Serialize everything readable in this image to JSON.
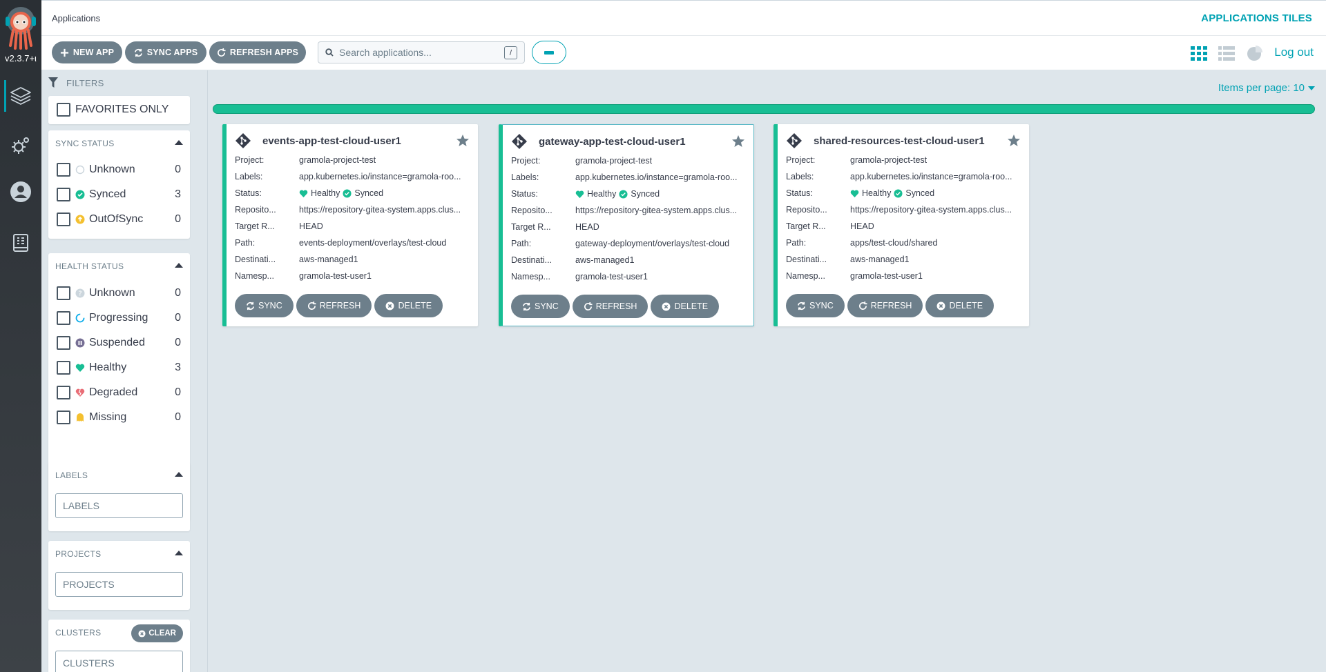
{
  "nav": {
    "version": "v2.3.7+ι",
    "items": [
      {
        "name": "applications"
      },
      {
        "name": "settings"
      },
      {
        "name": "user-info"
      },
      {
        "name": "documentation"
      }
    ]
  },
  "header": {
    "breadcrumb": "Applications",
    "view_title": "APPLICATIONS TILES"
  },
  "toolbar": {
    "new_app": "NEW APP",
    "sync_apps": "SYNC APPS",
    "refresh_apps": "REFRESH APPS",
    "search_placeholder": "Search applications...",
    "search_shortcut": "/",
    "logout": "Log out"
  },
  "filters": {
    "title": "FILTERS",
    "favorites_only": "FAVORITES ONLY",
    "sync_status": {
      "title": "SYNC STATUS",
      "items": [
        {
          "label": "Unknown",
          "count": "0"
        },
        {
          "label": "Synced",
          "count": "3"
        },
        {
          "label": "OutOfSync",
          "count": "0"
        }
      ]
    },
    "health_status": {
      "title": "HEALTH STATUS",
      "items": [
        {
          "label": "Unknown",
          "count": "0"
        },
        {
          "label": "Progressing",
          "count": "0"
        },
        {
          "label": "Suspended",
          "count": "0"
        },
        {
          "label": "Healthy",
          "count": "3"
        },
        {
          "label": "Degraded",
          "count": "0"
        },
        {
          "label": "Missing",
          "count": "0"
        }
      ]
    },
    "labels": {
      "title": "LABELS",
      "placeholder": "LABELS"
    },
    "projects": {
      "title": "PROJECTS",
      "placeholder": "PROJECTS"
    },
    "clusters": {
      "title": "CLUSTERS",
      "placeholder": "CLUSTERS",
      "clear": "CLEAR"
    }
  },
  "main": {
    "items_per_page": "Items per page: 10",
    "progress_fraction": 1.0,
    "field_labels": {
      "project": "Project:",
      "labels": "Labels:",
      "status": "Status:",
      "repository": "Reposito...",
      "target_revision": "Target R...",
      "path": "Path:",
      "destination": "Destinati...",
      "namespace": "Namesp..."
    },
    "actions": {
      "sync": "SYNC",
      "refresh": "REFRESH",
      "delete": "DELETE"
    },
    "apps": [
      {
        "name": "events-app-test-cloud-user1",
        "project": "gramola-project-test",
        "labels": "app.kubernetes.io/instance=gramola-roo...",
        "health": "Healthy",
        "sync": "Synced",
        "repository": "https://repository-gitea-system.apps.clus...",
        "target_revision": "HEAD",
        "path": "events-deployment/overlays/test-cloud",
        "destination": "aws-managed1",
        "namespace": "gramola-test-user1"
      },
      {
        "name": "gateway-app-test-cloud-user1",
        "project": "gramola-project-test",
        "labels": "app.kubernetes.io/instance=gramola-roo...",
        "health": "Healthy",
        "sync": "Synced",
        "repository": "https://repository-gitea-system.apps.clus...",
        "target_revision": "HEAD",
        "path": "gateway-deployment/overlays/test-cloud",
        "destination": "aws-managed1",
        "namespace": "gramola-test-user1"
      },
      {
        "name": "shared-resources-test-cloud-user1",
        "project": "gramola-project-test",
        "labels": "app.kubernetes.io/instance=gramola-roo...",
        "health": "Healthy",
        "sync": "Synced",
        "repository": "https://repository-gitea-system.apps.clus...",
        "target_revision": "HEAD",
        "path": "apps/test-cloud/shared",
        "destination": "aws-managed1",
        "namespace": "gramola-test-user1"
      }
    ]
  },
  "colors": {
    "accent": "#00a2b3",
    "healthy": "#18be94",
    "button": "#6d7f8b",
    "out_of_sync": "#f4c030",
    "degraded": "#e96d76"
  }
}
